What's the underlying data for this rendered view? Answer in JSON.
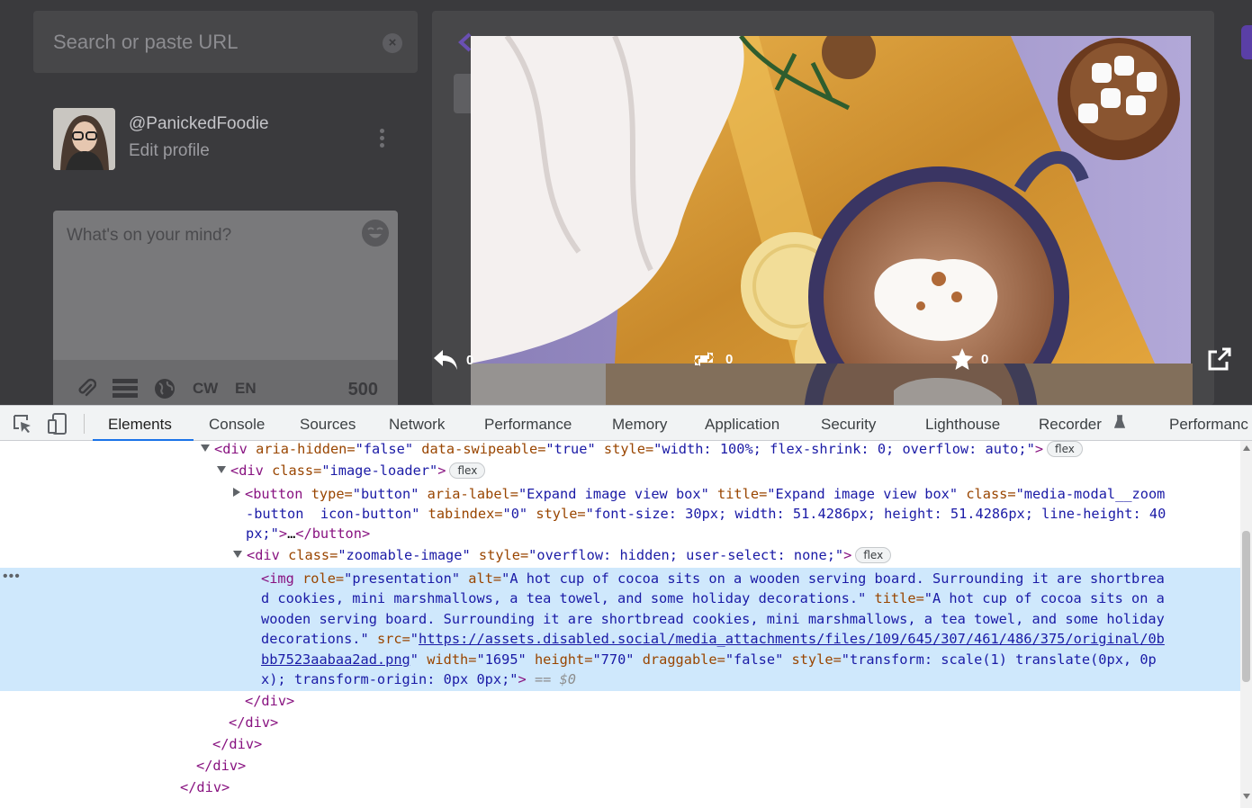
{
  "app": {
    "search_placeholder": "Search or paste URL",
    "profile": {
      "handle": "@PanickedFoodie",
      "edit_label": "Edit profile"
    },
    "compose": {
      "placeholder": "What's on your mind?",
      "tools": [
        "paperclip-icon",
        "poll-icon",
        "globe-icon"
      ],
      "cw_label": "CW",
      "lang_label": "EN",
      "char_count": "500"
    },
    "column_back_label": "Back",
    "media": {
      "actions": [
        {
          "icon": "reply-icon",
          "count": "0"
        },
        {
          "icon": "boost-icon",
          "count": "0"
        },
        {
          "icon": "star-icon",
          "count": "0"
        }
      ],
      "open_icon": "external-link-icon"
    }
  },
  "devtools": {
    "tabs": [
      "Elements",
      "Console",
      "Sources",
      "Network",
      "Performance",
      "Memory",
      "Application",
      "Security",
      "Lighthouse",
      "Recorder",
      "Performanc"
    ],
    "active_tab": "Elements",
    "selected_suffix": "== $0",
    "badge_flex": "flex",
    "accent": "#1a73e8",
    "dom_tags": {
      "div": "<div",
      "button": "<button",
      "img": "<img",
      "close_div": "</div>",
      "close_button": "</button>",
      "gt": ">",
      "ellipsis": "…"
    },
    "dom": {
      "row1": {
        "attrs": [
          "aria-hidden=",
          "data-swipeable=",
          "style="
        ],
        "vals": [
          "\"false\"",
          "\"true\"",
          "\"width: 100%; flex-shrink: 0; overflow: auto;\""
        ]
      },
      "row2": {
        "attr": "class=",
        "val": "\"image-loader\""
      },
      "row3": {
        "attrs": [
          "type=",
          "aria-label=",
          "title=",
          "class=",
          "tabindex=",
          "style="
        ],
        "vals": [
          "\"button\"",
          "\"Expand image view box\"",
          "\"Expand image view box\"",
          "\"media-modal__zoom",
          "-button  icon-button\"",
          "\"0\"",
          "\"font-size: 30px; width: 51.4286px; height: 51.4286px; line-height: 40",
          "px;\""
        ]
      },
      "row4": {
        "attrs": [
          "class=",
          "style="
        ],
        "vals": [
          "\"zoomable-image\"",
          "\"overflow: hidden; user-select: none;\""
        ]
      },
      "img": {
        "attrs": [
          "role=",
          "alt=",
          "title=",
          "src=",
          "width=",
          "height=",
          "draggable=",
          "style="
        ],
        "role": "\"presentation\"",
        "alt_lines": [
          "\"A hot cup of cocoa sits on a wooden serving board. Surrounding it are shortbrea",
          "d cookies, mini marshmallows, a tea towel, and some holiday decorations.\""
        ],
        "title_lines": [
          "\"A hot cup of cocoa sits on a",
          "wooden serving board. Surrounding it are shortbread cookies, mini marshmallows, a tea towel, and some holiday",
          "decorations.\""
        ],
        "src_quote": "\"",
        "src_lines": [
          "https://assets.disabled.social/media_attachments/files/109/645/307/461/486/375/original/0b",
          "bb7523aabaa2ad.png"
        ],
        "width": "\"1695\"",
        "height": "\"770\"",
        "draggable": "\"false\"",
        "style_lines": [
          "\"transform: scale(1) translate(0px, 0p",
          "x); transform-origin: 0px 0px;\""
        ]
      }
    }
  }
}
